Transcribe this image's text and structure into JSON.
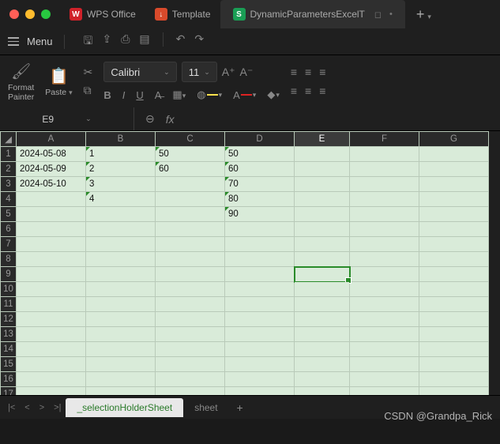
{
  "titlebar": {
    "tabs": [
      {
        "icon_bg": "#d0222a",
        "icon_text": "W",
        "label": "WPS Office"
      },
      {
        "icon_bg": "#d94a2b",
        "icon_text": "↓",
        "label": "Template"
      },
      {
        "icon_bg": "#1a9e55",
        "icon_text": "S",
        "label": "DynamicParametersExcelT"
      }
    ]
  },
  "menubar": {
    "menu_label": "Menu"
  },
  "ribbon": {
    "format_painter_label": "Format\nPainter",
    "paste_label": "Paste",
    "font_name": "Calibri",
    "font_size": "11"
  },
  "refbar": {
    "namebox": "E9",
    "fx": "fx"
  },
  "columns": [
    "A",
    "B",
    "C",
    "D",
    "E",
    "F",
    "G"
  ],
  "rows": [
    "1",
    "2",
    "3",
    "4",
    "5",
    "6",
    "7",
    "8",
    "9",
    "10",
    "11",
    "12",
    "13",
    "14",
    "15",
    "16",
    "17"
  ],
  "cells": {
    "A1": "2024-05-08",
    "A2": "2024-05-09",
    "A3": "2024-05-10",
    "B1": "1",
    "B2": "2",
    "B3": "3",
    "B4": "4",
    "C1": "50",
    "C2": "60",
    "D1": "50",
    "D2": "60",
    "D3": "70",
    "D4": "80",
    "D5": "90"
  },
  "selected": {
    "col": "E",
    "row": "9"
  },
  "sheetbar": {
    "tabs": [
      {
        "label": "_selectionHolderSheet",
        "active": true
      },
      {
        "label": "sheet",
        "active": false
      }
    ]
  },
  "watermark": "CSDN @Grandpa_Rick"
}
